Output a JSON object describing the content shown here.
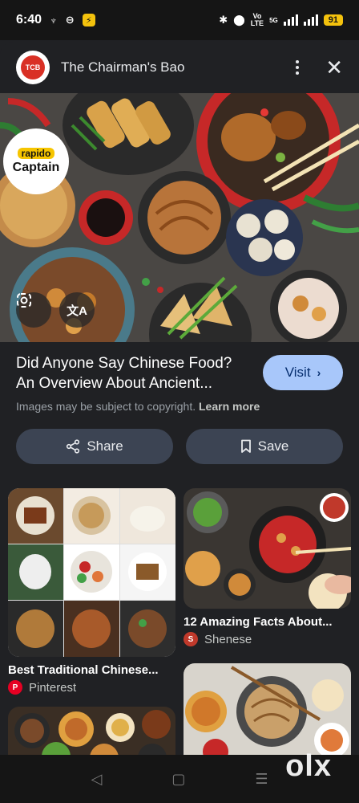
{
  "status_bar": {
    "time": "6:40",
    "network_label_top": "Vo",
    "network_label_bottom": "LTE",
    "signal_label": "5G",
    "battery": "91"
  },
  "header": {
    "site_name": "The Chairman's Bao",
    "site_logo_text": "TCB"
  },
  "hero": {
    "badge_small": "rapido",
    "badge_big": "Captain",
    "lens_icon": "lens-icon",
    "translate_icon": "translate-icon"
  },
  "result": {
    "title": "Did Anyone Say Chinese Food? An Overview About Ancient...",
    "visit_label": "Visit",
    "copyright_text": "Images may be subject to copyright.",
    "learn_more": "Learn more"
  },
  "actions": {
    "share_label": "Share",
    "save_label": "Save"
  },
  "related": [
    {
      "title": "Best Traditional Chinese...",
      "source": "Pinterest",
      "source_color": "#e60023"
    },
    {
      "title": "12 Amazing Facts About...",
      "source": "Shenese",
      "source_color": "#c0392b"
    }
  ],
  "nav": {
    "back": "◁",
    "home": "▢",
    "recents": "☰"
  },
  "watermark": "olx",
  "colors": {
    "accent": "#a8c7fa",
    "button_bg": "#3c4453",
    "background": "#202124"
  }
}
